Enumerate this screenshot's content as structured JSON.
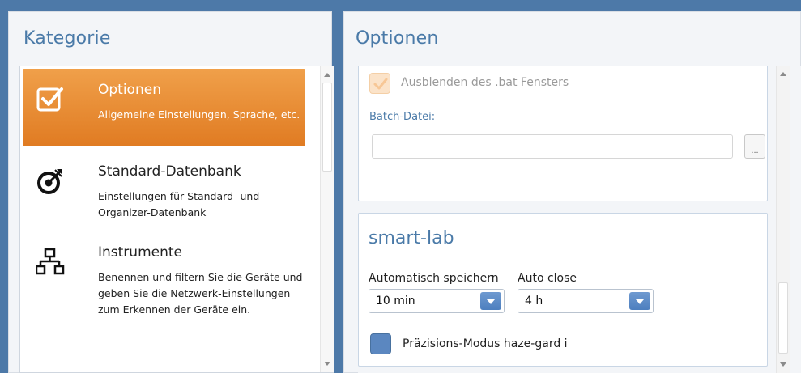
{
  "kategorie": {
    "title": "Kategorie",
    "items": [
      {
        "title": "Optionen",
        "desc": "Allgemeine Einstellungen, Sprache, etc.",
        "icon": "checkbox-icon",
        "active": true
      },
      {
        "title": "Standard-Datenbank",
        "desc": "Einstellungen für Standard- und Organizer-Datenbank",
        "icon": "target-arrow-icon",
        "active": false
      },
      {
        "title": "Instrumente",
        "desc": "Benennen und filtern Sie die Geräte und geben Sie die Netzwerk-Einstellungen zum Erkennen der Geräte ein.",
        "icon": "network-icon",
        "active": false
      }
    ]
  },
  "optionen": {
    "title": "Optionen",
    "hide_bat": {
      "label": "Ausblenden des .bat Fensters",
      "checked": true,
      "enabled": false
    },
    "batch_file": {
      "label": "Batch-Datei:",
      "value": "",
      "browse_label": "..."
    },
    "smart_lab": {
      "title": "smart-lab",
      "auto_save": {
        "label": "Automatisch speichern",
        "value": "10 min"
      },
      "auto_close": {
        "label": "Auto close",
        "value": "4 h"
      },
      "precision": {
        "label": "Präzisions-Modus haze-gard i",
        "checked": false
      }
    }
  },
  "colors": {
    "accent": "#4a7aa8",
    "active_item_top": "#f0a04a",
    "active_item_bottom": "#e07b22",
    "window_bg": "#4d79a8"
  }
}
